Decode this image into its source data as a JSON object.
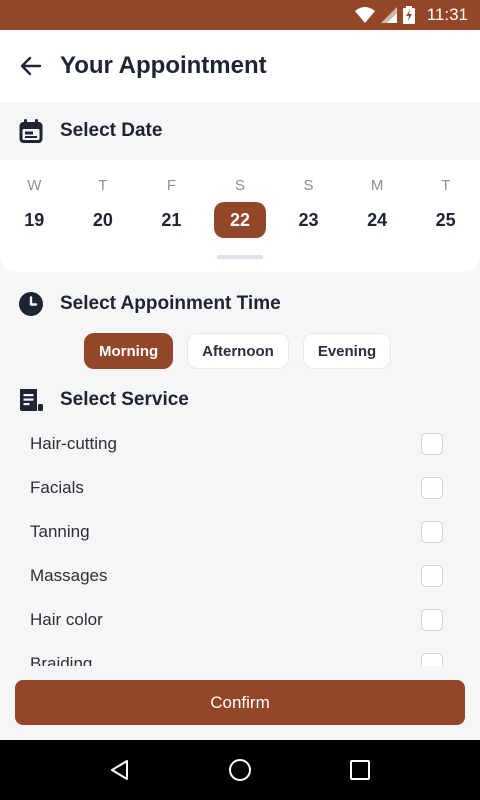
{
  "status_bar": {
    "time": "11:31"
  },
  "header": {
    "title": "Your Appointment"
  },
  "date_section": {
    "label": "Select Date",
    "days": [
      {
        "dow": "W",
        "num": "19"
      },
      {
        "dow": "T",
        "num": "20"
      },
      {
        "dow": "F",
        "num": "21"
      },
      {
        "dow": "S",
        "num": "22"
      },
      {
        "dow": "S",
        "num": "23"
      },
      {
        "dow": "M",
        "num": "24"
      },
      {
        "dow": "T",
        "num": "25"
      }
    ],
    "selected_index": 3
  },
  "time_section": {
    "label": "Select Appoinment Time",
    "tabs": [
      {
        "label": "Morning"
      },
      {
        "label": "Afternoon"
      },
      {
        "label": "Evening"
      }
    ],
    "active_index": 0
  },
  "service_section": {
    "label": "Select Service",
    "items": [
      {
        "name": "Hair-cutting",
        "checked": false
      },
      {
        "name": "Facials",
        "checked": false
      },
      {
        "name": "Tanning",
        "checked": false
      },
      {
        "name": "Massages",
        "checked": false
      },
      {
        "name": "Hair color",
        "checked": false
      },
      {
        "name": "Braiding",
        "checked": false
      }
    ]
  },
  "confirm_label": "Confirm",
  "colors": {
    "accent": "#934628",
    "background": "#f6f6f8",
    "text": "#1f2433"
  },
  "icons": {
    "back": "arrow-left-icon",
    "date": "calendar-icon",
    "time": "clock-icon",
    "service": "document-icon"
  }
}
